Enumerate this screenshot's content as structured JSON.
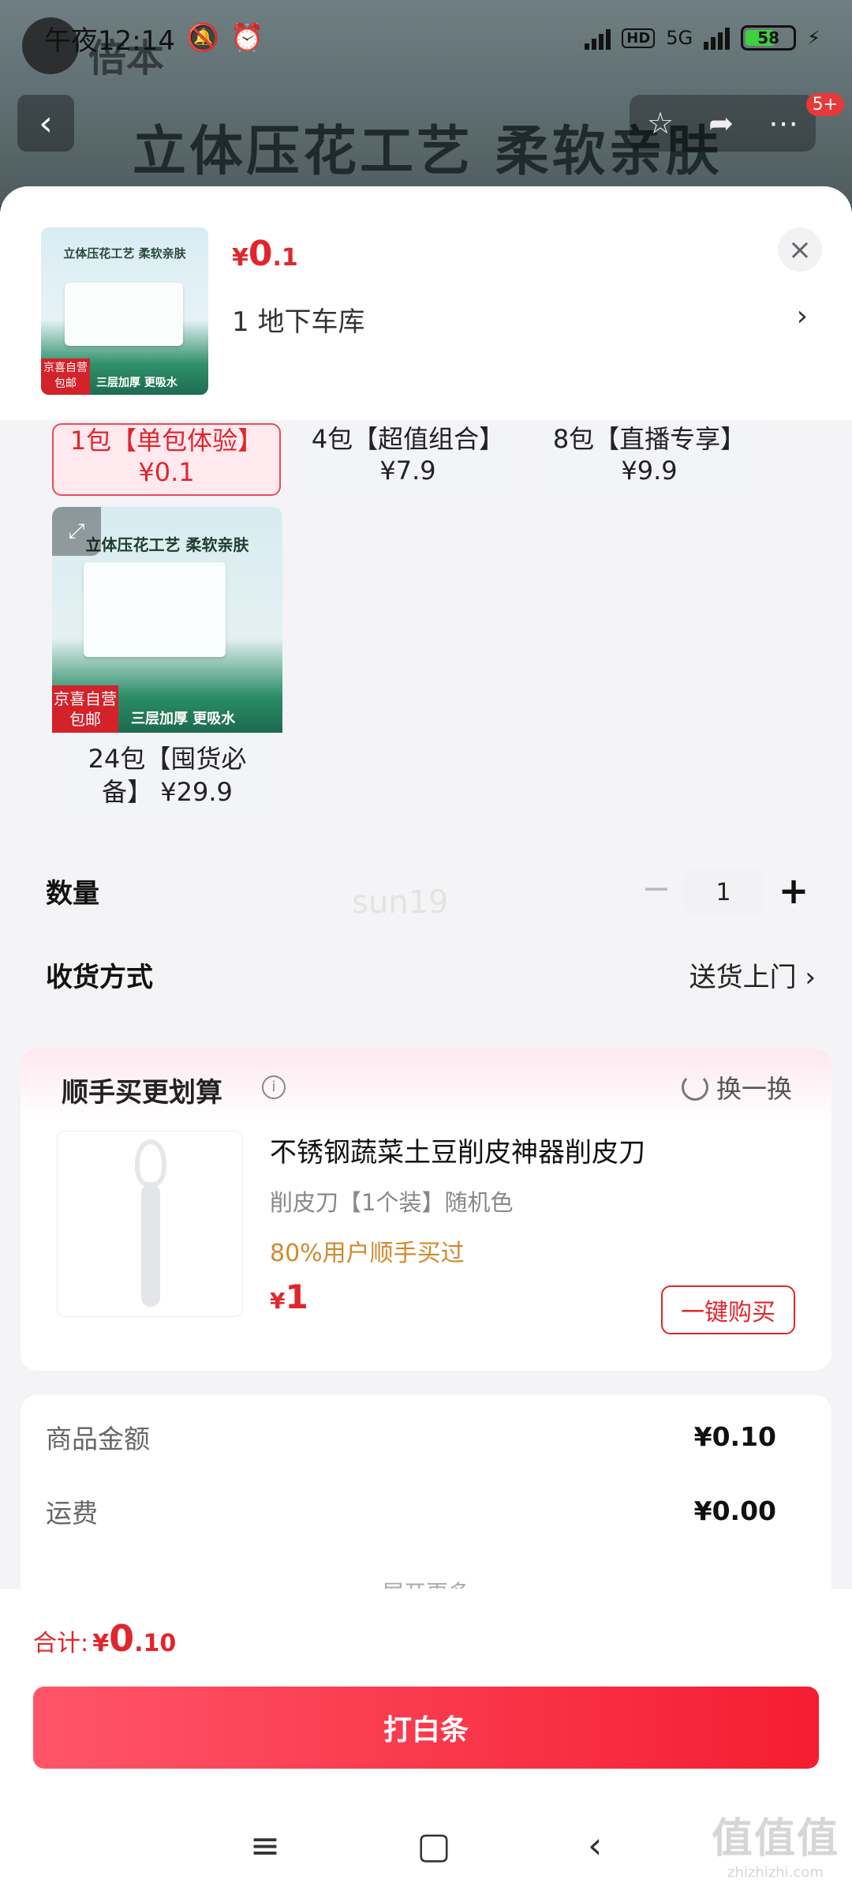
{
  "status_bar": {
    "time": "午夜12:14",
    "network": "5G",
    "hd": "HD",
    "battery": "58"
  },
  "background": {
    "brand": "倍本",
    "headline": "立体压花工艺 柔软亲肤",
    "badge": "5+"
  },
  "sheet": {
    "thumb": {
      "title": "立体压花工艺 柔软亲肤",
      "tag_top": "京喜自营",
      "tag_bottom": "包邮",
      "strip": "三层加厚 更吸水"
    },
    "price": {
      "currency": "¥",
      "int": "0",
      "dec": ".1"
    },
    "address": "1 地下车库",
    "options": [
      {
        "line1": "1包【单包体验】",
        "line2": "¥0.1",
        "selected": true
      },
      {
        "line1": "4包【超值组合】",
        "line2": "¥7.9",
        "selected": false
      },
      {
        "line1": "8包【直播专享】",
        "line2": "¥9.9",
        "selected": false
      }
    ],
    "option_24": {
      "headline": "立体压花工艺 柔软亲肤",
      "tag_top": "京喜自营",
      "tag_bottom": "包邮",
      "strip": "三层加厚 更吸水",
      "label": "24包【囤货必备】 ¥29.9"
    },
    "quantity": {
      "label": "数量",
      "value": "1"
    },
    "shipping": {
      "label": "收货方式",
      "value": "送货上门"
    },
    "watermark": "sun19"
  },
  "upsell": {
    "title": "顺手买更划算",
    "refresh": "换一换",
    "product": {
      "name": "不锈钢蔬菜土豆削皮神器削皮刀",
      "spec": "削皮刀【1个装】随机色",
      "social": "80%用户顺手买过",
      "price_cur": "¥",
      "price_int": "1",
      "buy": "一键购买"
    }
  },
  "summary": {
    "rows": [
      {
        "label": "商品金额",
        "value": "¥0.10"
      },
      {
        "label": "运费",
        "value": "¥0.00"
      }
    ],
    "more": "展开更多"
  },
  "bottom": {
    "total_label": "合计:",
    "total_cur": "¥",
    "total_int": "0",
    "total_dec": ".10",
    "pay": "打白条"
  },
  "site_mark": {
    "big": "值值值",
    "small": "zhizhizhi.com"
  }
}
